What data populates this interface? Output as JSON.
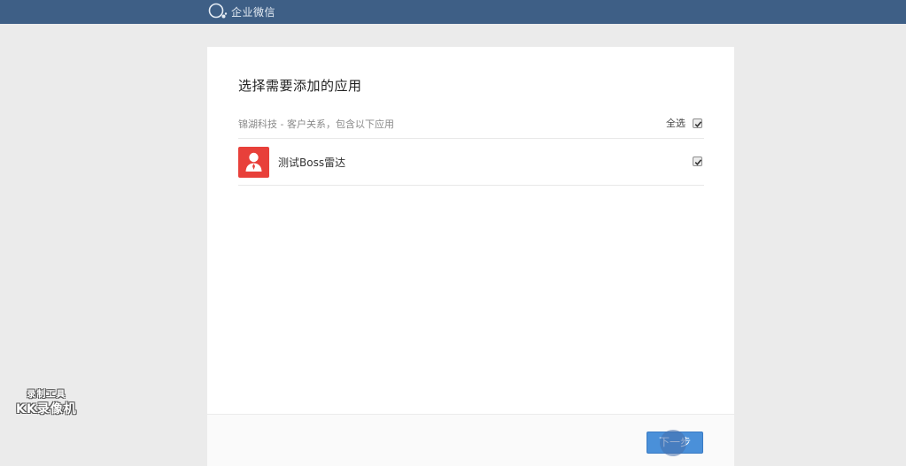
{
  "topbar": {
    "brand_name": "企业微信",
    "logo_icon": "wechat-work-logo-icon"
  },
  "dialog": {
    "title": "选择需要添加的应用",
    "group_label": "锦湖科技 - 客户关系，包含以下应用",
    "select_all_label": "全选",
    "select_all_checked": true,
    "apps": [
      {
        "name": "测试Boss雷达",
        "icon": "person-icon",
        "icon_color": "#e8403a",
        "checked": true
      }
    ],
    "next_button_label": "下一步"
  },
  "watermark": {
    "line1": "录制工具",
    "line2": "KK录像机"
  },
  "colors": {
    "topbar": "#3e5f86",
    "accent": "#4a90d9",
    "background": "#ebebeb"
  }
}
